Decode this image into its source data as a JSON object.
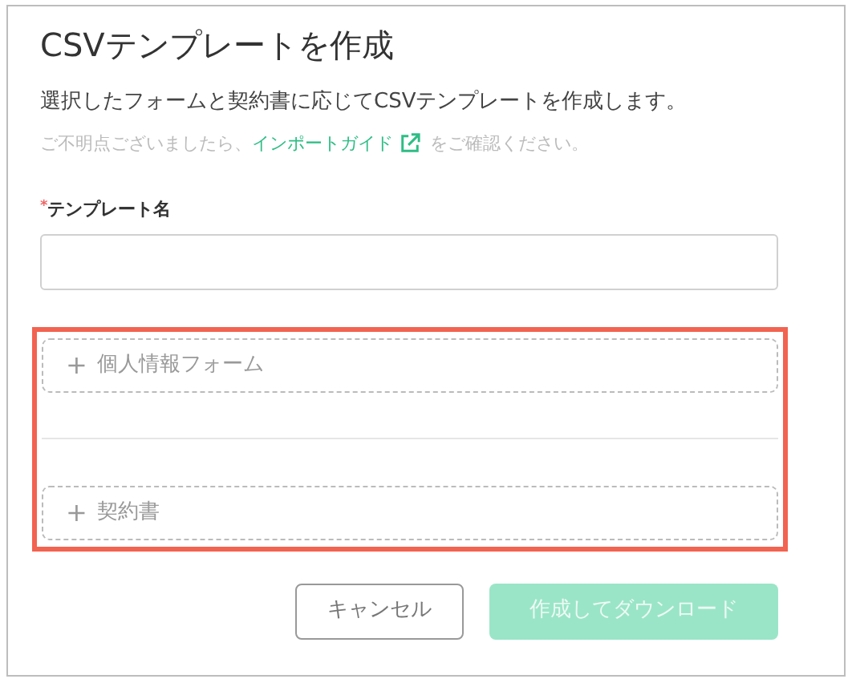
{
  "dialog": {
    "title": "CSVテンプレートを作成",
    "description": "選択したフォームと契約書に応じてCSVテンプレートを作成します。",
    "hint": {
      "before": "ご不明点ございましたら、",
      "link": "インポートガイド",
      "after": "をご確認ください。"
    },
    "template_name": {
      "required_mark": "*",
      "label": "テンプレート名"
    },
    "highlighted": true,
    "add_slots": [
      {
        "icon": "+",
        "label": "個人情報フォーム"
      },
      {
        "icon": "+",
        "label": "契約書"
      }
    ],
    "buttons": [
      {
        "label": "キャンセル",
        "kind": "secondary",
        "disabled": false
      },
      {
        "label": "作成してダウンロード",
        "kind": "primary",
        "disabled": true
      }
    ]
  }
}
